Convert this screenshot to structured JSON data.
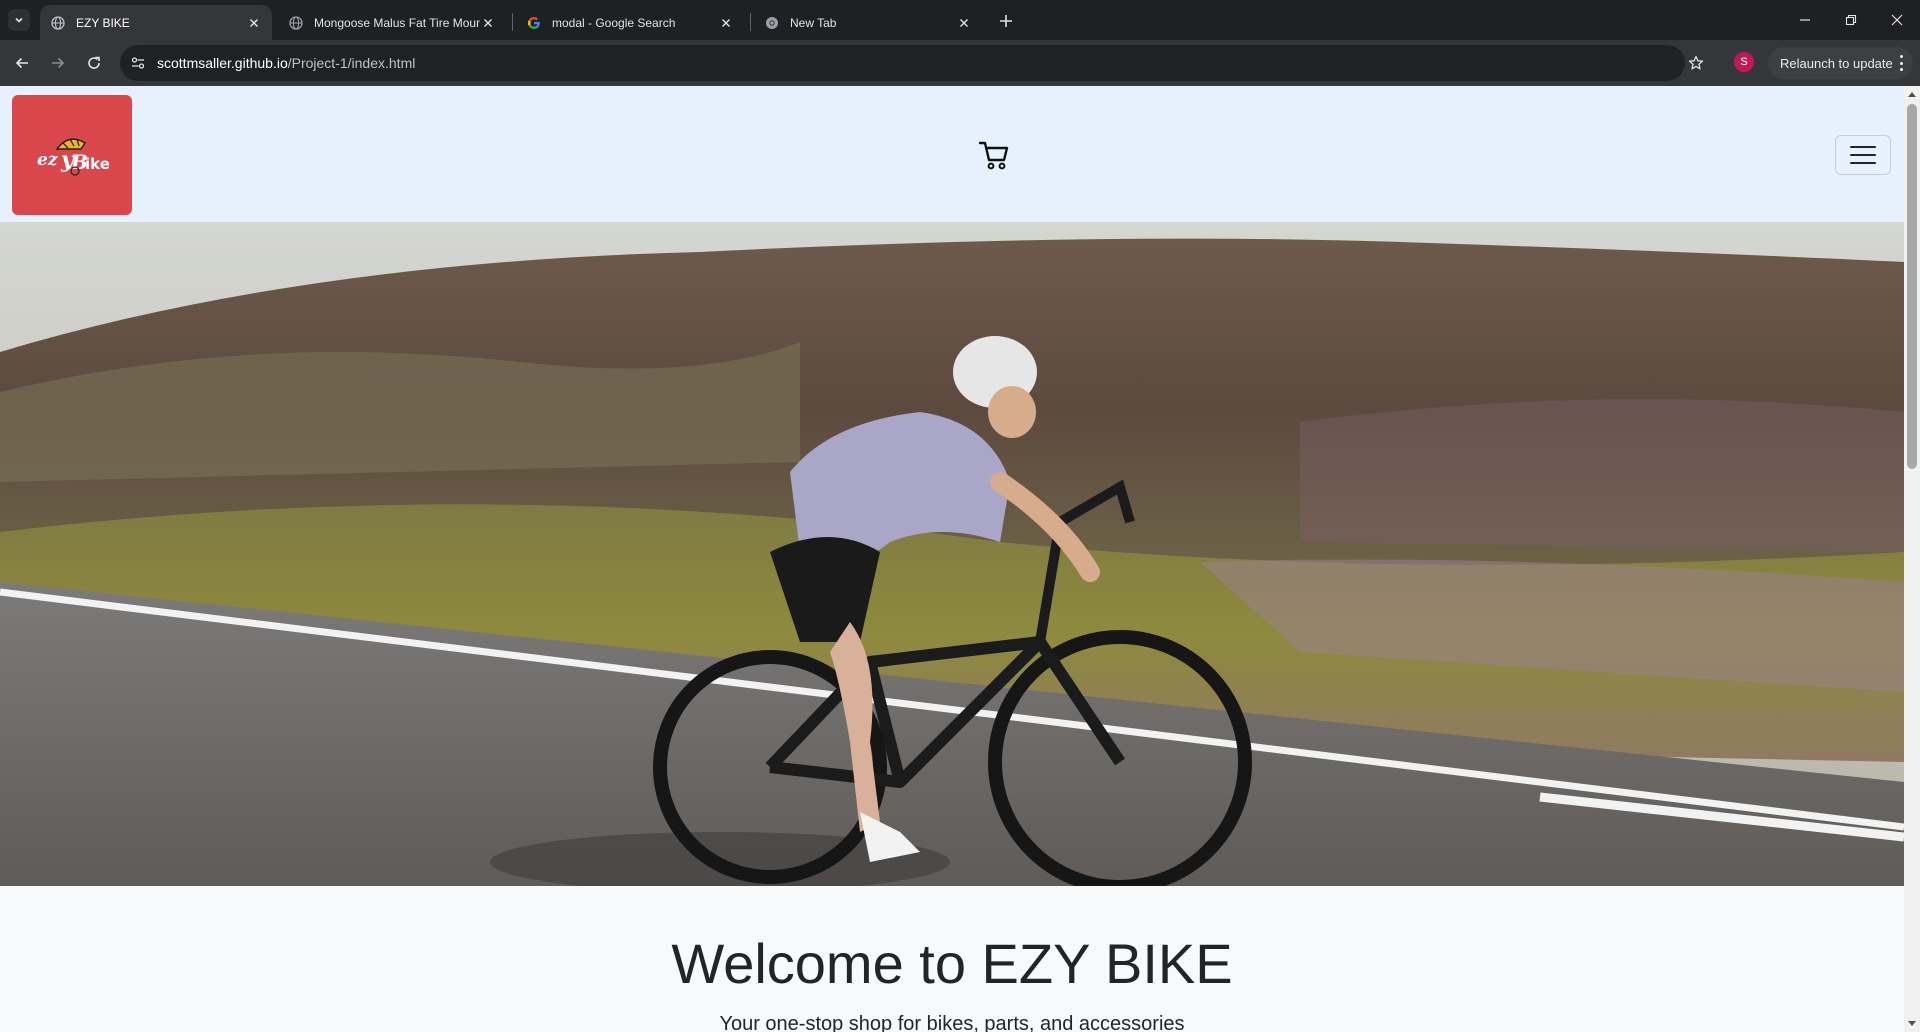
{
  "browser": {
    "tabs": [
      {
        "title": "EZY BIKE",
        "active": true,
        "favicon": "globe-icon"
      },
      {
        "title": "Mongoose Malus Fat Tire Moun",
        "active": false,
        "favicon": "globe-icon"
      },
      {
        "title": "modal - Google Search",
        "active": false,
        "favicon": "google-icon"
      },
      {
        "title": "New Tab",
        "active": false,
        "favicon": "chrome-icon"
      }
    ],
    "url_host": "scottmsaller.github.io",
    "url_path": "/Project-1/index.html",
    "profile_initial": "S",
    "relaunch_label": "Relaunch to update"
  },
  "site": {
    "logo_text": "ezyBike",
    "header_bg": "#e6f1fd",
    "logo_bg": "#d9474c",
    "hero_alt": "Cyclist riding a road bike through hills",
    "welcome_title": "Welcome to EZY BIKE",
    "welcome_subtitle": "Your one-stop shop for bikes, parts, and accessories"
  },
  "icons": [
    "cart-icon",
    "hamburger-menu-icon",
    "back-icon",
    "forward-icon",
    "reload-icon",
    "star-icon",
    "site-info-icon"
  ]
}
